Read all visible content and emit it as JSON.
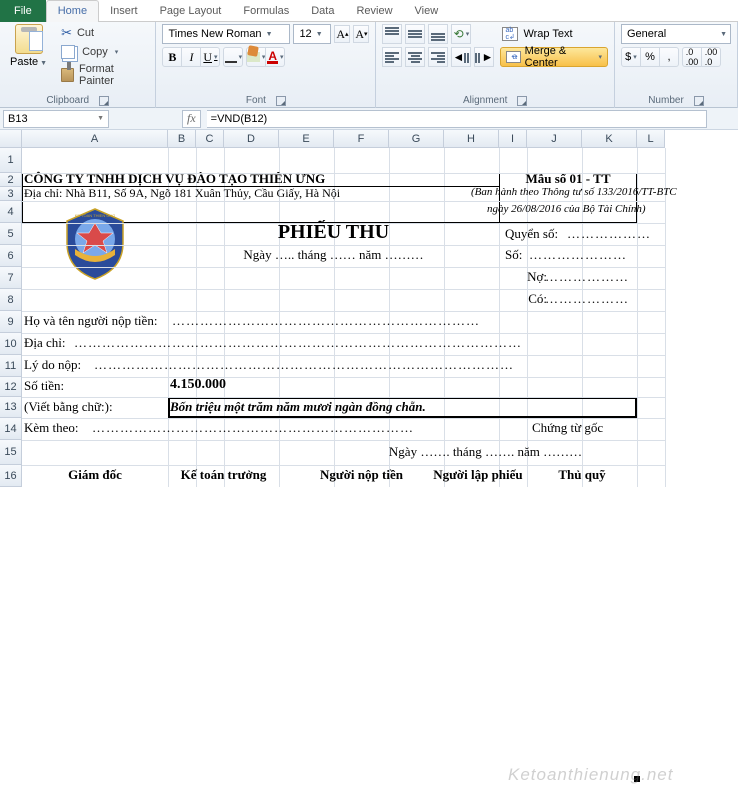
{
  "ribbon": {
    "file": "File",
    "tabs": [
      "Home",
      "Insert",
      "Page Layout",
      "Formulas",
      "Data",
      "Review",
      "View"
    ],
    "active_tab": "Home",
    "clipboard": {
      "paste": "Paste",
      "cut": "Cut",
      "copy": "Copy",
      "format_painter": "Format Painter",
      "label": "Clipboard"
    },
    "font": {
      "name": "Times New Roman",
      "size": "12",
      "label": "Font"
    },
    "alignment": {
      "wrap": "Wrap Text",
      "merge": "Merge & Center",
      "label": "Alignment"
    },
    "number": {
      "format": "General",
      "label": "Number"
    }
  },
  "addrbar": {
    "cell": "B13",
    "formula": "=VND(B12)"
  },
  "cols": [
    "A",
    "B",
    "C",
    "D",
    "E",
    "F",
    "G",
    "H",
    "I",
    "J",
    "K",
    "L"
  ],
  "rows": [
    "1",
    "2",
    "3",
    "4",
    "5",
    "6",
    "7",
    "8",
    "9",
    "10",
    "11",
    "12",
    "13",
    "14",
    "15",
    "16"
  ],
  "doc": {
    "company": "CÔNG TY TNHH DỊCH VỤ ĐÀO TẠO THIÊN ƯNG",
    "form_no": "Mẫu số 01 - TT",
    "address_lbl": "Địa chỉ: Nhà B11, Số 9A, Ngõ 181 Xuân Thủy, Cầu Giấy, Hà Nội",
    "issued1": "(Ban hành theo Thông tư số 133/2016/TT-BTC",
    "issued2": "ngày 26/08/2016 của Bộ Tài Chính)",
    "title": "PHIẾU THU",
    "date_line": "Ngày ….. tháng …… năm ………",
    "quyen": "Quyển số:",
    "quyen_dots": "………………",
    "so": "Số:",
    "so_dots": "…………………",
    "no": "Nợ:",
    "no_dots": "………………",
    "co": "Có:",
    "co_dots": "………………",
    "hoten": "Họ và tên người nộp tiền:",
    "hoten_dots": "…………………………………………………………",
    "diachi": "Địa chỉ:",
    "diachi_dots": "……………………………………………………………………………………",
    "lydo": "Lý do nộp:",
    "lydo_dots": "………………………………………………………………………………",
    "sotien": "Số tiền:",
    "amount": "4.150.000",
    "viet": "(Viết bằng chữ:):",
    "words": "Bốn triệu một trăm năm mươi ngàn đồng chẵn.",
    "kem": "Kèm theo:",
    "kem_dots": "……………………………………………………………",
    "chungtu": "Chứng từ gốc",
    "date2": "Ngày ……. tháng ……. năm ………",
    "sig1": "Giám đốc",
    "sig2": "Kế toán trưởng",
    "sig3": "Người nộp tiền",
    "sig4": "Người lập phiếu",
    "sig5": "Thủ quỹ"
  },
  "watermark": "Ketoanthienung.net"
}
